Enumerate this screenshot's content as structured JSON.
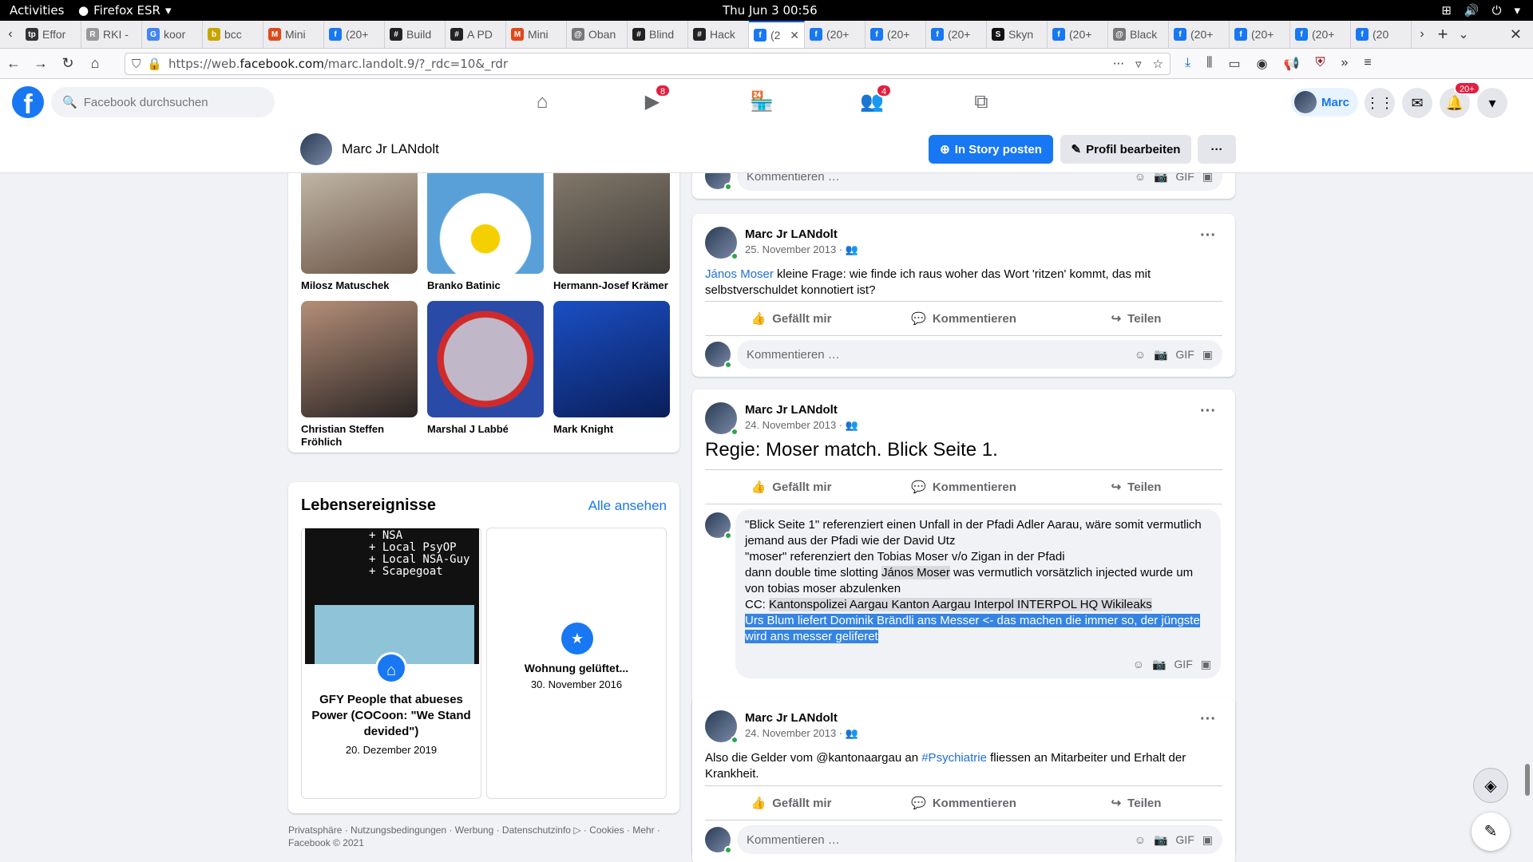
{
  "system": {
    "activities": "Activities",
    "app": "Firefox ESR",
    "clock": "Thu Jun 3  00:56"
  },
  "tabs": [
    {
      "label": "Effor",
      "fav": "tp",
      "color": "#333"
    },
    {
      "label": "RKI -",
      "fav": "R",
      "color": "#999"
    },
    {
      "label": "koor",
      "fav": "G",
      "color": "#4285f4"
    },
    {
      "label": "bcc",
      "fav": "b",
      "color": "#c8a400"
    },
    {
      "label": "Mini",
      "fav": "M",
      "color": "#e0491a"
    },
    {
      "label": "(20+",
      "fav": "f",
      "color": "#1877f2"
    },
    {
      "label": "Build",
      "fav": "#",
      "color": "#222"
    },
    {
      "label": "A PD",
      "fav": "#",
      "color": "#222"
    },
    {
      "label": "Mini",
      "fav": "M",
      "color": "#e0491a"
    },
    {
      "label": "Oban",
      "fav": "@",
      "color": "#777"
    },
    {
      "label": "Blind",
      "fav": "#",
      "color": "#222"
    },
    {
      "label": "Hack",
      "fav": "#",
      "color": "#222"
    },
    {
      "label": "(2",
      "fav": "f",
      "color": "#1877f2",
      "active": true
    },
    {
      "label": "(20+",
      "fav": "f",
      "color": "#1877f2"
    },
    {
      "label": "(20+",
      "fav": "f",
      "color": "#1877f2"
    },
    {
      "label": "(20+",
      "fav": "f",
      "color": "#1877f2"
    },
    {
      "label": "Skyn",
      "fav": "S",
      "color": "#111"
    },
    {
      "label": "(20+",
      "fav": "f",
      "color": "#1877f2"
    },
    {
      "label": "Black",
      "fav": "@",
      "color": "#777"
    },
    {
      "label": "(20+",
      "fav": "f",
      "color": "#1877f2"
    },
    {
      "label": "(20+",
      "fav": "f",
      "color": "#1877f2"
    },
    {
      "label": "(20+",
      "fav": "f",
      "color": "#1877f2"
    },
    {
      "label": "(20",
      "fav": "f",
      "color": "#1877f2"
    }
  ],
  "url": {
    "prefix": "https://web.",
    "host": "facebook.com",
    "path": "/marc.landolt.9/?_rdc=10&_rdr"
  },
  "fb": {
    "search_placeholder": "Facebook durchsuchen",
    "video_badge": "8",
    "groups_badge": "4",
    "notif_badge": "20+",
    "account": "Marc",
    "brand": "#1877f2"
  },
  "profile": {
    "name": "Marc Jr LANdolt",
    "story_btn": "In Story posten",
    "edit_btn": "Profil bearbeiten",
    "more_btn": "···"
  },
  "friends": [
    {
      "name": "Milosz Matuschek",
      "bg": "linear-gradient(160deg,#c9c0b0,#6b5546)"
    },
    {
      "name": "Branko Batinic",
      "bg": "radial-gradient(circle at 50% 70%,#f5d000 0 14%,#fff 15% 45%,#5aa0d8 46%)"
    },
    {
      "name": "Hermann-Josef Krämer",
      "bg": "linear-gradient(160deg,#8a7f70,#3d3a36)"
    },
    {
      "name": "Christian Steffen Fröhlich",
      "bg": "linear-gradient(160deg,#b48e78,#2a2424)"
    },
    {
      "name": "Marshal J Labbé",
      "bg": "radial-gradient(circle,#c0b8c8 0 50%,#d02a2a 51% 58%,#2a4aa8 59%)"
    },
    {
      "name": "Mark Knight",
      "bg": "linear-gradient(160deg,#1b4fc4,#0a1e5a)"
    }
  ],
  "life": {
    "title": "Lebensereignisse",
    "see_all": "Alle ansehen",
    "event1": {
      "title": "GFY People that abueses Power (COCoon: \"We Stand devided\")",
      "date": "20. Dezember 2019"
    },
    "event2": {
      "title": "Wohnung gelüftet...",
      "date": "30. November 2016"
    },
    "meme_lines": [
      "+ NSA",
      "+ Local PsyOP",
      "+ Local NSA-Guy",
      "+ Scapegoat"
    ]
  },
  "footer": "Privatsphäre · Nutzungsbedingungen · Werbung · Datenschutzinfo ▷ · Cookies · Mehr · Facebook © 2021",
  "actions": {
    "like": "Gefällt mir",
    "comment": "Kommentieren",
    "share": "Teilen",
    "placeholder": "Kommentieren …"
  },
  "posts": [
    {
      "author": "Marc Jr LANdolt",
      "date": "25. November 2013 · 👥",
      "mention": "János Moser",
      "text": " kleine Frage: wie finde ich raus woher das Wort 'ritzen' kommt, das mit selbstverschuldet konnotiert ist?"
    },
    {
      "author": "Marc Jr LANdolt",
      "date": "24. November 2013 · 👥",
      "text": "Regie: Moser match. Blick Seite 1.",
      "comment": {
        "l1": "\"Blick Seite 1\" referenziert einen Unfall in der Pfadi Adler Aarau, wäre somit vermutlich jemand aus der Pfadi wie der David Utz",
        "l2": "\"moser\" referenziert den Tobias Moser v/o Zigan in der Pfadi",
        "l3a": "dann double time slotting ",
        "l3m": "János Moser",
        "l3b": " was vermutlich vorsätzlich injected wurde um von tobias moser abzulenken",
        "cc": "CC: ",
        "tags": "Kantonspolizei Aargau Kanton Aargau Interpol INTERPOL HQ Wikileaks",
        "sel": "Urs Blum liefert Dominik Brändli ans Messer <- das machen die immer so, der jüngste wird ans messer geliferet"
      }
    },
    {
      "author": "Marc Jr LANdolt",
      "date": "24. November 2013 · 👥",
      "t1": "Also die Gelder vom @kantonaargau an ",
      "tag": "#Psychiatrie",
      "t2": " fliessen an Mitarbeiter und Erhalt der Krankheit."
    }
  ]
}
